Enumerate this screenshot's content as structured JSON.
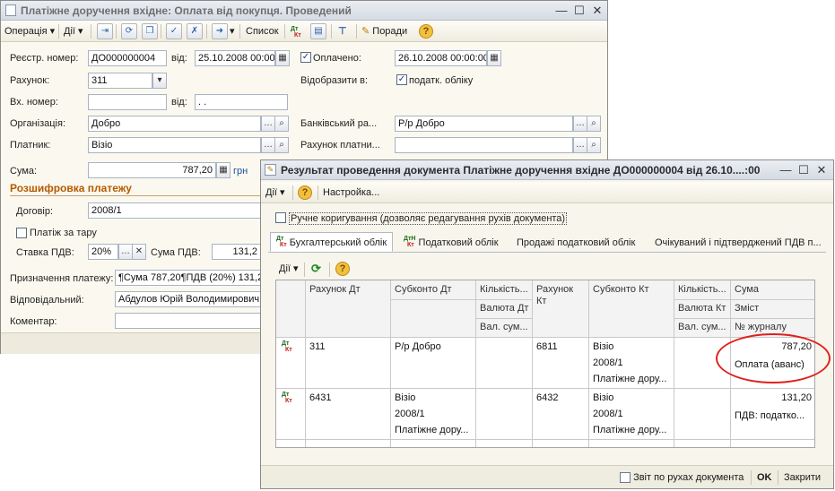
{
  "main_window": {
    "title": "Платіжне доручення вхідне: Оплата від покупця. Проведений",
    "toolbar": {
      "operation": "Операція",
      "actions": "Дії",
      "list": "Список",
      "tips": "Поради"
    },
    "fields": {
      "reg_number_label": "Реєстр. номер:",
      "reg_number": "ДО000000004",
      "from_label": "від:",
      "reg_date": "25.10.2008 00:00",
      "paid_label": "Оплачено:",
      "paid_date": "26.10.2008 00:00:00",
      "account_label": "Рахунок:",
      "account": "311",
      "reflect_label": "Відобразити в:",
      "tax_accounting_label": "податк. обліку",
      "in_number_label": "Вх. номер:",
      "in_number": "",
      "in_from_label": "від:",
      "in_date": ". .",
      "org_label": "Організація:",
      "org": "Добро",
      "bank_label": "Банківський ра...",
      "bank": "Р/р Добро",
      "payer_label": "Платник:",
      "payer": "Візіо",
      "payer_account_label": "Рахунок платни...",
      "payer_account": "",
      "sum_label": "Сума:",
      "sum": "787,20",
      "currency": "грн",
      "section_title": "Розшифровка платежу",
      "contract_label": "Договір:",
      "contract": "2008/1",
      "tare_label": "Платіж за тару",
      "vat_rate_label": "Ставка ПДВ:",
      "vat_rate": "20%",
      "vat_sum_label": "Сума ПДВ:",
      "vat_sum": "131,2",
      "purpose_label": "Призначення платежу:",
      "purpose": "¶Сума 787,20¶ПДВ (20%) 131,2",
      "responsible_label": "Відповідальний:",
      "responsible": "Абдулов Юрій Володимирович",
      "comment_label": "Коментар:",
      "comment": ""
    }
  },
  "result_window": {
    "title": "Результат проведення документа Платіжне доручення вхідне ДО000000004 від 26.10....:00",
    "toolbar": {
      "actions": "Дії",
      "settings": "Настройка..."
    },
    "manual_edit_label": "Ручне коригування (дозволяє редагування рухів документа)",
    "tabs": [
      "Бухгалтерський облік",
      "Податковий облік",
      "Продажі податковий облік",
      "Очікуваний і підтверджений ПДВ п..."
    ],
    "inner_actions": "Дії",
    "columns": {
      "account_dt": "Рахунок Дт",
      "subconto_dt": "Субконто Дт",
      "qty_dt": "Кількість...",
      "currency_dt": "Валюта Дт",
      "cur_sum_dt": "Вал. сум...",
      "account_kt": "Рахунок Кт",
      "subconto_kt": "Субконто Кт",
      "qty_kt": "Кількість...",
      "currency_kt": "Валюта Кт",
      "cur_sum_kt": "Вал. сум...",
      "sum": "Сума",
      "content": "Зміст",
      "journal_no": "№ журналу"
    },
    "rows": [
      {
        "icon_dt": "Дт",
        "icon_kt": "Кт",
        "account_dt": "311",
        "subconto_dt": [
          "Р/р Добро"
        ],
        "account_kt": "6811",
        "subconto_kt": [
          "Візіо",
          "2008/1",
          "Платіжне дору..."
        ],
        "sum": "787,20",
        "content": "Оплата (аванс)"
      },
      {
        "icon_dt": "Дт",
        "icon_kt": "Кт",
        "account_dt": "6431",
        "subconto_dt": [
          "Візіо",
          "2008/1",
          "Платіжне дору..."
        ],
        "account_kt": "6432",
        "subconto_kt": [
          "Візіо",
          "2008/1",
          "Платіжне дору..."
        ],
        "sum": "131,20",
        "content": "ПДВ: податко..."
      }
    ],
    "footer": {
      "report": "Звіт по рухах документа",
      "ok": "OK",
      "close": "Закрити"
    }
  },
  "colors": {
    "highlight_ellipse": "#e0201c",
    "section_title": "#b45a00",
    "window_bg": "#fbf9ef"
  }
}
